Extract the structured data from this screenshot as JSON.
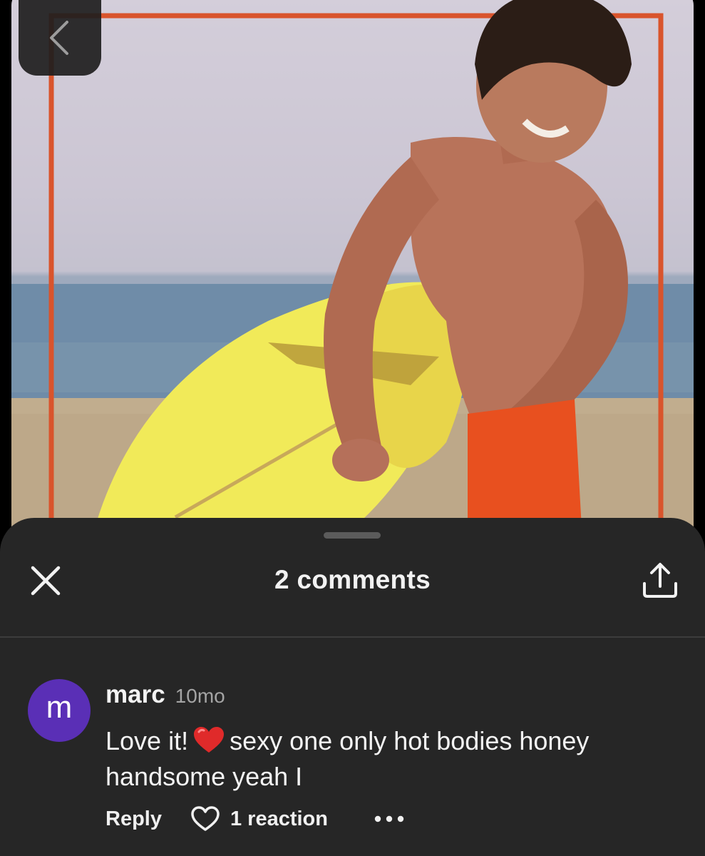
{
  "photo": {
    "alt": ""
  },
  "sheet": {
    "title": "2 comments"
  },
  "comment": {
    "avatar_letter": "m",
    "avatar_color": "#5a2fb6",
    "author": "marc",
    "time": "10mo",
    "text_before_emoji": "Love it!",
    "emoji": "red-heart-emoji",
    "text_after_emoji": "sexy one only hot bodies honey handsome yeah I",
    "reply_label": "Reply",
    "reaction_label": "1 reaction"
  },
  "icons": {
    "back": "chevron-left-icon",
    "close": "close-icon",
    "share": "share-icon",
    "react": "heart-outline-icon",
    "more": "more-dots-icon"
  },
  "colors": {
    "sheet_bg": "#262626",
    "photo_border": "#d9542c",
    "surfboard": "#f0ea5a",
    "shorts": "#e8501f"
  }
}
